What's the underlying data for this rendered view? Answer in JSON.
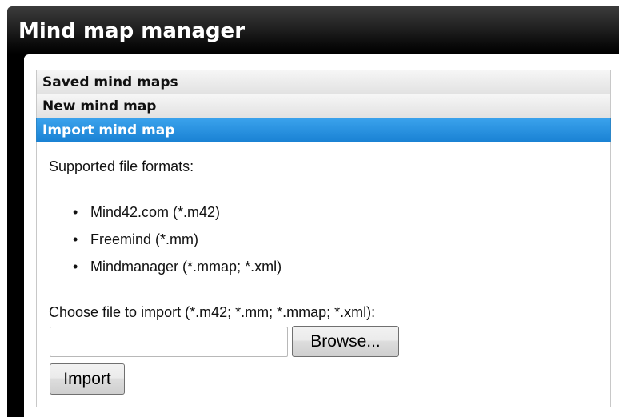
{
  "window": {
    "title": "Mind map manager"
  },
  "accordion": {
    "sections": [
      {
        "label": "Saved mind maps",
        "active": false
      },
      {
        "label": "New mind map",
        "active": false
      },
      {
        "label": "Import mind map",
        "active": true
      }
    ]
  },
  "import": {
    "intro": "Supported file formats:",
    "formats": [
      "Mind42.com (*.m42)",
      "Freemind (*.mm)",
      "Mindmanager (*.mmap; *.xml)"
    ],
    "bullet": "•",
    "choose_label": "Choose file to import (*.m42; *.mm; *.mmap; *.xml):",
    "file_value": "",
    "browse_label": "Browse...",
    "import_label": "Import"
  },
  "colors": {
    "active_header": "#1a82d4",
    "title_bar": "#000000"
  }
}
